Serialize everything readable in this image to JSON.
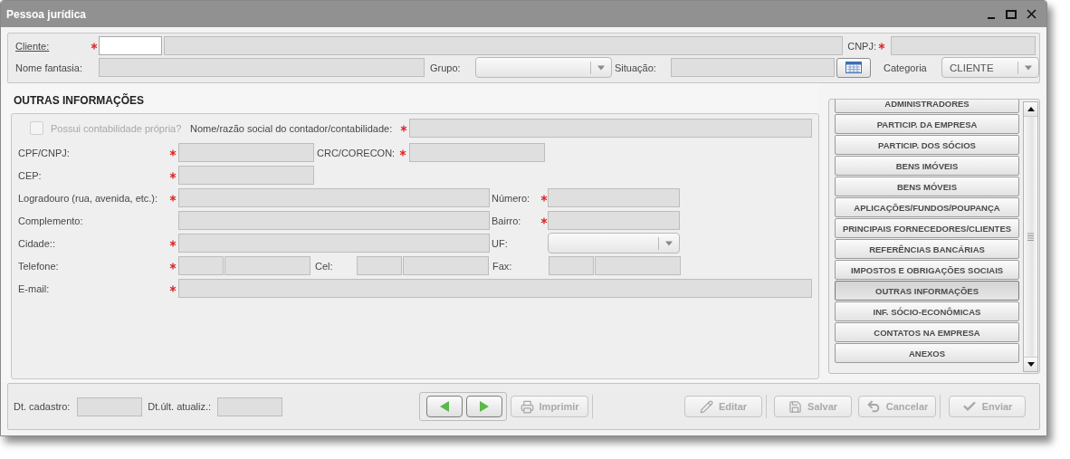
{
  "window": {
    "title": "Pessoa jurídica"
  },
  "header": {
    "cliente": {
      "label": "Cliente:",
      "required": true
    },
    "cnpj": {
      "label": "CNPJ:",
      "required": true
    },
    "nome_fantasia": {
      "label": "Nome fantasia:"
    },
    "grupo": {
      "label": "Grupo:"
    },
    "situacao": {
      "label": "Situação:"
    },
    "categoria": {
      "label": "Categoria",
      "value": "CLIENTE"
    }
  },
  "section": {
    "title": "OUTRAS INFORMAÇÕES"
  },
  "form": {
    "possui_contabilidade": {
      "label": "Possui contabilidade própria?",
      "checked": false,
      "disabled": true
    },
    "nome_contador": {
      "label": "Nome/razão social do contador/contabilidade:",
      "required": true
    },
    "cpf_cnpj": {
      "label": "CPF/CNPJ:",
      "required": true
    },
    "crc": {
      "label": "CRC/CORECON:",
      "required": true
    },
    "cep": {
      "label": "CEP:",
      "required": true
    },
    "logradouro": {
      "label": "Logradouro (rua, avenida, etc.):",
      "required": true
    },
    "numero": {
      "label": "Número:",
      "required": true
    },
    "complemento": {
      "label": "Complemento:",
      "required": false
    },
    "bairro": {
      "label": "Bairro:",
      "required": true
    },
    "cidade": {
      "label": "Cidade::",
      "required": true
    },
    "uf": {
      "label": "UF:",
      "required": false
    },
    "telefone": {
      "label": "Telefone:",
      "required": true
    },
    "cel": {
      "label": "Cel:",
      "required": false
    },
    "fax": {
      "label": "Fax:",
      "required": false
    },
    "email": {
      "label": "E-mail:",
      "required": true
    }
  },
  "side_menu": {
    "items": [
      {
        "label": "ADMINISTRADORES",
        "selected": false
      },
      {
        "label": "PARTICIP. DA EMPRESA",
        "selected": false
      },
      {
        "label": "PARTICIP. DOS SÓCIOS",
        "selected": false
      },
      {
        "label": "BENS IMÓVEIS",
        "selected": false
      },
      {
        "label": "BENS MÓVEIS",
        "selected": false
      },
      {
        "label": "APLICAÇÕES/FUNDOS/POUPANÇA",
        "selected": false
      },
      {
        "label": "PRINCIPAIS FORNECEDORES/CLIENTES",
        "selected": false
      },
      {
        "label": "REFERÊNCIAS BANCÁRIAS",
        "selected": false
      },
      {
        "label": "IMPOSTOS E OBRIGAÇÕES SOCIAIS",
        "selected": false
      },
      {
        "label": "OUTRAS INFORMAÇÕES",
        "selected": true
      },
      {
        "label": "INF. SÓCIO-ECONÔMICAS",
        "selected": false
      },
      {
        "label": "CONTATOS NA EMPRESA",
        "selected": false
      },
      {
        "label": "ANEXOS",
        "selected": false
      }
    ]
  },
  "footer": {
    "dt_cadastro": {
      "label": "Dt. cadastro:"
    },
    "dt_atualiz": {
      "label": "Dt.últ. atualiz.:"
    },
    "buttons": [
      {
        "kind": "print",
        "label": "Imprimir",
        "disabled": true
      },
      {
        "kind": "edit",
        "label": "Editar",
        "disabled": true
      },
      {
        "kind": "save",
        "label": "Salvar",
        "disabled": true
      },
      {
        "kind": "cancel",
        "label": "Cancelar",
        "disabled": true
      },
      {
        "kind": "send",
        "label": "Enviar",
        "disabled": true
      }
    ]
  }
}
